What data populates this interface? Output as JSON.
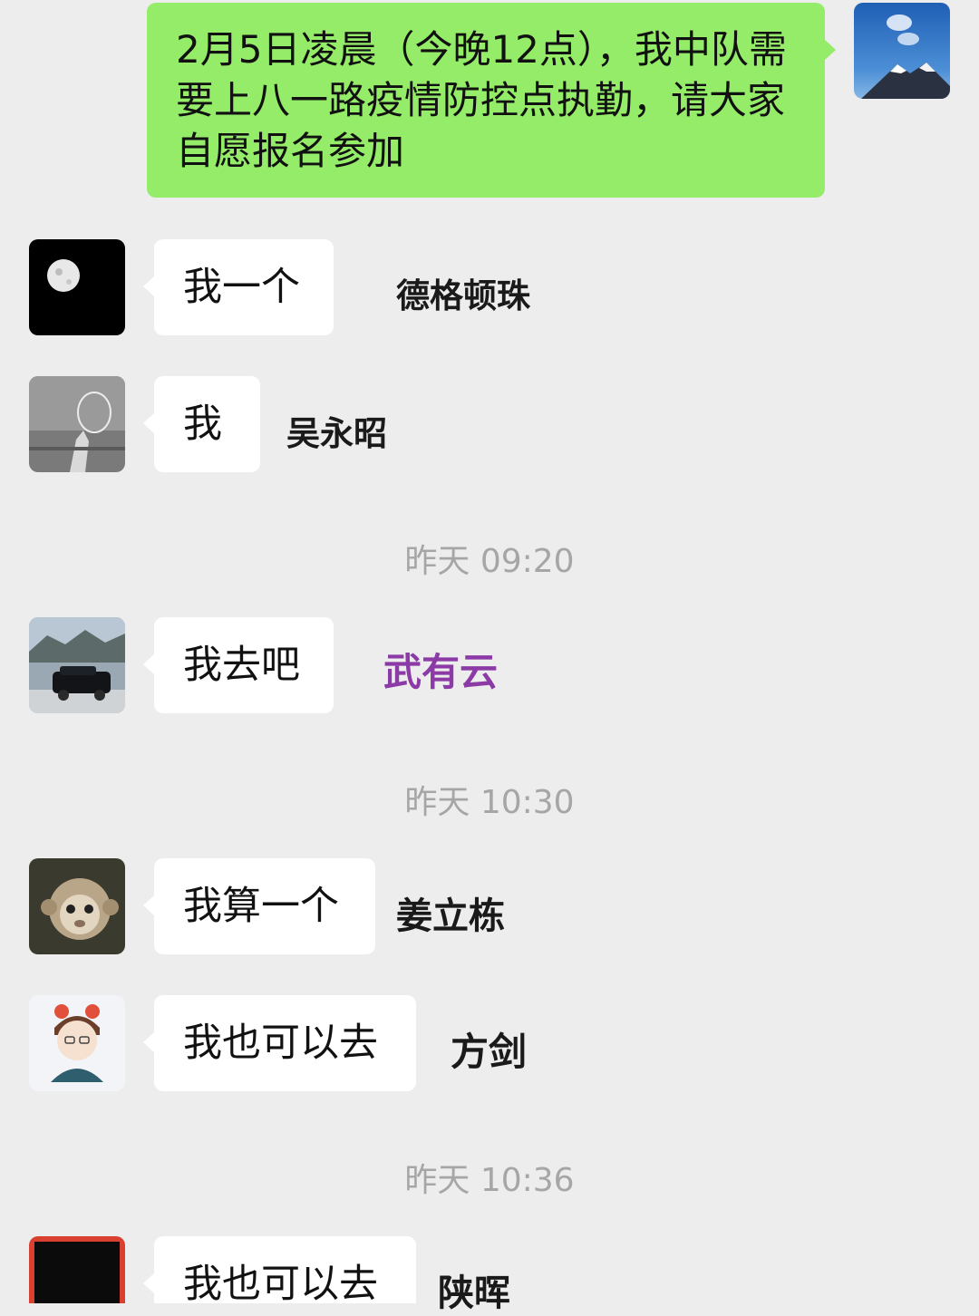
{
  "messages": {
    "m0": {
      "text": "2月5日凌晨（今晚12点），我中队需要上八一路疫情防控点执勤，请大家自愿报名参加"
    },
    "m1": {
      "text": "我一个",
      "sender": "德格顿珠"
    },
    "m2": {
      "text": "我",
      "sender": "吴永昭"
    },
    "m3": {
      "text": "我去吧",
      "sender": "武有云"
    },
    "m4": {
      "text": "我算一个",
      "sender": "姜立栋"
    },
    "m5": {
      "text": "我也可以去",
      "sender": "方剑"
    },
    "m6": {
      "text": "我也可以去",
      "sender": "陕晖"
    }
  },
  "timestamps": {
    "t1": "昨天 09:20",
    "t2": "昨天 10:30",
    "t3": "昨天 10:36"
  },
  "colors": {
    "background": "#ededed",
    "own_bubble": "#95ec69",
    "other_bubble": "#ffffff",
    "timestamp": "#a6a6a6",
    "highlight_name": "#8b3aa6"
  }
}
